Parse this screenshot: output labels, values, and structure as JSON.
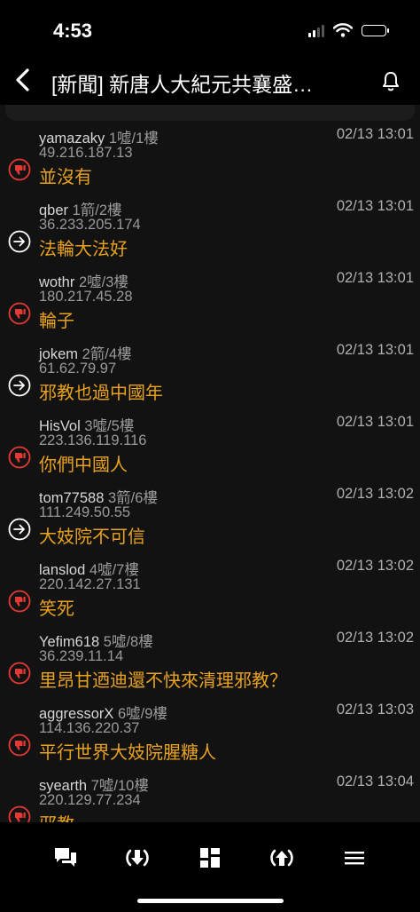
{
  "status": {
    "time": "4:53"
  },
  "header": {
    "title": "[新聞] 新唐人大紀元共襄盛…"
  },
  "comments": [
    {
      "type": "boo",
      "user": "yamazaky",
      "meta": "1噓/1樓",
      "time": "02/13 13:01",
      "ip": "49.216.187.13",
      "text": "並沒有"
    },
    {
      "type": "arrow",
      "user": "qber",
      "meta": "1箭/2樓",
      "time": "02/13 13:01",
      "ip": "36.233.205.174",
      "text": "法輪大法好"
    },
    {
      "type": "boo",
      "user": "wothr",
      "meta": "2噓/3樓",
      "time": "02/13 13:01",
      "ip": "180.217.45.28",
      "text": "輪子"
    },
    {
      "type": "arrow",
      "user": "jokem",
      "meta": "2箭/4樓",
      "time": "02/13 13:01",
      "ip": "61.62.79.97",
      "text": "邪教也過中國年"
    },
    {
      "type": "boo",
      "user": "HisVol",
      "meta": "3噓/5樓",
      "time": "02/13 13:01",
      "ip": "223.136.119.116",
      "text": "你們中國人"
    },
    {
      "type": "arrow",
      "user": "tom77588",
      "meta": "3箭/6樓",
      "time": "02/13 13:02",
      "ip": "111.249.50.55",
      "text": "大妓院不可信"
    },
    {
      "type": "boo",
      "user": "lanslod",
      "meta": "4噓/7樓",
      "time": "02/13 13:02",
      "ip": "220.142.27.131",
      "text": "笑死"
    },
    {
      "type": "boo",
      "user": "Yefim618",
      "meta": "5噓/8樓",
      "time": "02/13 13:02",
      "ip": "36.239.11.14",
      "text": "里昂甘迺迪還不快來清理邪教？"
    },
    {
      "type": "boo",
      "user": "aggressorX",
      "meta": "6噓/9樓",
      "time": "02/13 13:03",
      "ip": "114.136.220.37",
      "text": "平行世界大妓院腥糖人"
    },
    {
      "type": "boo",
      "user": "syearth",
      "meta": "7噓/10樓",
      "time": "02/13 13:04",
      "ip": "220.129.77.234",
      "text": "邪教"
    }
  ],
  "toolbar": {
    "items": [
      {
        "icon": "comments-icon"
      },
      {
        "icon": "scroll-bottom-icon"
      },
      {
        "icon": "grid-icon"
      },
      {
        "icon": "scroll-top-icon"
      },
      {
        "icon": "menu-icon"
      }
    ]
  },
  "colors": {
    "background": "#121212",
    "bars": "#000000",
    "message": "#e8a21e",
    "boo": "#e53935",
    "arrow": "#ffffff"
  }
}
